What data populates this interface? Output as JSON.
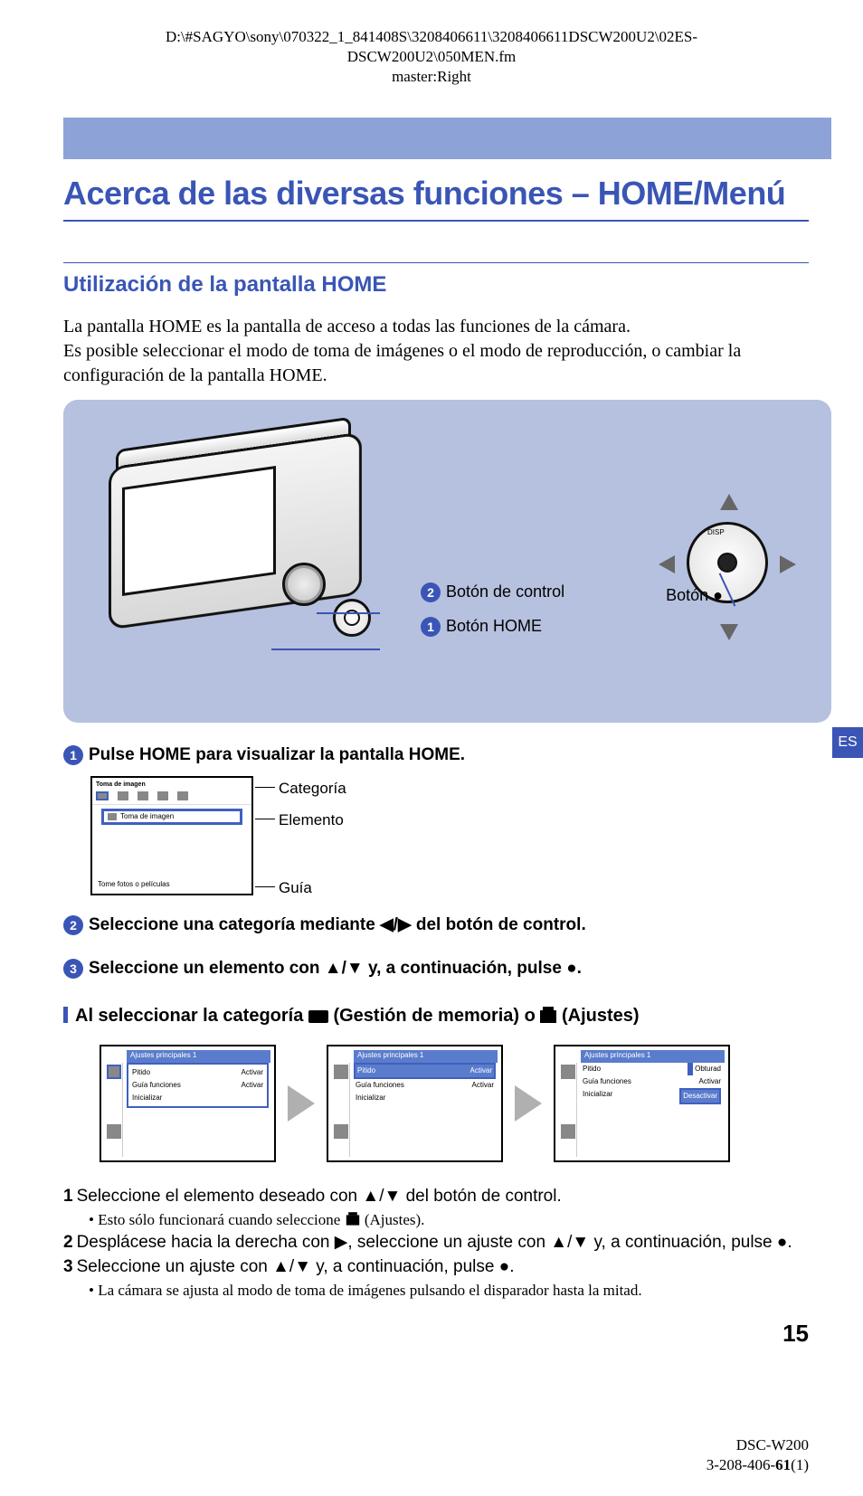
{
  "pathHeader": {
    "line1": "D:\\#SAGYO\\sony\\070322_1_841408S\\3208406611\\3208406611DSCW200U2\\02ES-",
    "line2": "DSCW200U2\\050MEN.fm",
    "line3": "master:Right"
  },
  "h1": "Acerca de las diversas funciones – HOME/Menú",
  "h2": "Utilización de la pantalla HOME",
  "intro": "La pantalla HOME es la pantalla de acceso a todas las funciones de la cámara.\nEs posible seleccionar el modo de toma de imágenes o el modo de reproducción, o cambiar la configuración de la pantalla HOME.",
  "tab": "ES",
  "illus": {
    "label2": "Botón de control",
    "label1": "Botón HOME",
    "labelPadPrefix": "Botón ",
    "padDisp": "DISP"
  },
  "step1": "Pulse HOME para visualizar la pantalla HOME.",
  "callouts": {
    "categoria": "Categoría",
    "elemento": "Elemento",
    "guia": "Guía"
  },
  "miniScreen": {
    "top": "Toma de imagen",
    "sel": "Toma de imagen",
    "guide": "Tome fotos o películas"
  },
  "step2": "Seleccione una categoría mediante ◀/▶ del botón de control.",
  "step3": "Seleccione un elemento con ▲/▼ y, a continuación, pulse ●.",
  "subheadA": "Al seleccionar la categoría",
  "subheadB": "(Gestión de memoria) o",
  "subheadC": "(Ajustes)",
  "settingsScreens": {
    "hdr": "Ajustes principales 1",
    "r1a": "Pitido",
    "r1b": "Activar",
    "r2a": "Guía funciones",
    "r2b": "Activar",
    "r3a": "Inicializar",
    "s3r1b": "Obturad",
    "s3r2b": "Activar",
    "s3r3b": "Desactivar"
  },
  "sub1": "Seleccione el elemento deseado con ▲/▼ del botón de control.",
  "sub1note": "• Esto sólo funcionará cuando seleccione",
  "sub1noteTail": "(Ajustes).",
  "sub2": "Desplácese hacia la derecha con ▶, seleccione un ajuste con ▲/▼ y, a continuación, pulse ●.",
  "sub3": "Seleccione un ajuste con ▲/▼ y, a continuación, pulse ●.",
  "sub3note": "• La cámara se ajusta al modo de toma de imágenes pulsando el disparador hasta la mitad.",
  "pageNum": "15",
  "footer1": "DSC-W200",
  "footer2a": "3-208-406-",
  "footer2b": "61",
  "footer2c": "(1)"
}
